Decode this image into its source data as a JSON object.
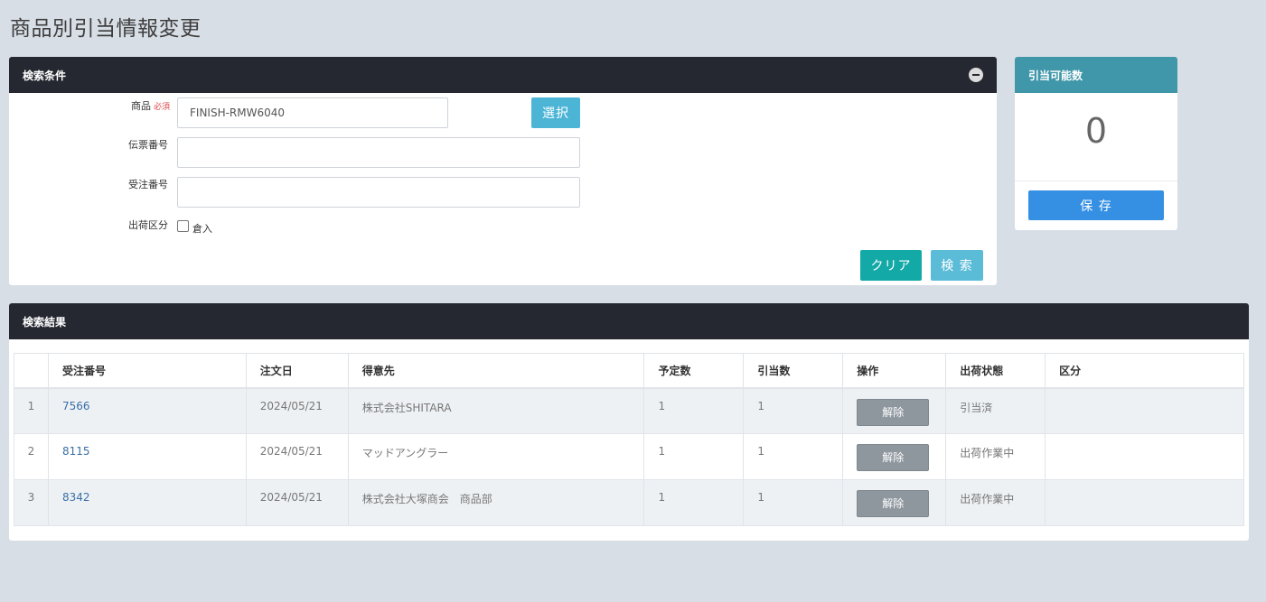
{
  "page": {
    "title": "商品別引当情報変更"
  },
  "search": {
    "header": "検索条件",
    "product_label": "商品",
    "required_mark": "必須",
    "product_value": "FINISH-RMW6040",
    "select_button": "選択",
    "slip_label": "伝票番号",
    "slip_value": "",
    "order_label": "受注番号",
    "order_value": "",
    "ship_type_label": "出荷区分",
    "warehouse_in_label": "倉入",
    "warehouse_in_checked": false,
    "clear_button": "クリア",
    "search_button": "検 索"
  },
  "alloc": {
    "header": "引当可能数",
    "value": "0",
    "save_button": "保 存"
  },
  "results": {
    "header": "検索結果",
    "columns": [
      "",
      "受注番号",
      "注文日",
      "得意先",
      "予定数",
      "引当数",
      "操作",
      "出荷状態",
      "区分"
    ],
    "rows": [
      {
        "idx": "1",
        "order_no": "7566",
        "date": "2024/05/21",
        "customer": "株式会社SHITARA",
        "planned": "1",
        "allocated": "1",
        "action": "解除",
        "status": "引当済",
        "category": ""
      },
      {
        "idx": "2",
        "order_no": "8115",
        "date": "2024/05/21",
        "customer": "マッドアングラー",
        "planned": "1",
        "allocated": "1",
        "action": "解除",
        "status": "出荷作業中",
        "category": ""
      },
      {
        "idx": "3",
        "order_no": "8342",
        "date": "2024/05/21",
        "customer": "株式会社大塚商会　商品部",
        "planned": "1",
        "allocated": "1",
        "action": "解除",
        "status": "出荷作業中",
        "category": ""
      }
    ]
  },
  "colors": {
    "header_dark": "#252830",
    "header_teal": "#3f97a9",
    "clear_button": "#12a9a6",
    "search_button": "#5bbcd8",
    "select_button": "#4cb5d6",
    "save_button": "#3590e4",
    "release_button": "#8e969e"
  }
}
